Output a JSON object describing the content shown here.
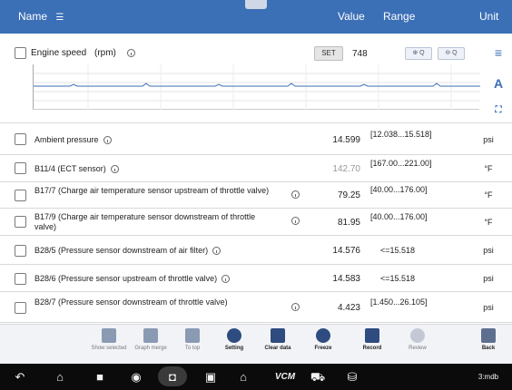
{
  "header": {
    "name_label": "Name",
    "value_label": "Value",
    "range_label": "Range",
    "unit_label": "Unit"
  },
  "graph": {
    "param_name": "Engine speed",
    "param_unit": "(rpm)",
    "set_label": "SET",
    "current_value": "748"
  },
  "rows": [
    {
      "name": "Ambient pressure",
      "value": "14.599",
      "range": "[12.038...15.518]",
      "unit": "psi",
      "info_inline": true
    },
    {
      "name": "B11/4 (ECT sensor)",
      "value": "142.70",
      "range": "[167.00...221.00]",
      "unit": "°F",
      "info_inline": true,
      "dim": true
    },
    {
      "name": "B17/7 (Charge air temperature sensor upstream of throttle valve)",
      "value": "79.25",
      "range": "[40.00...176.00]",
      "unit": "°F"
    },
    {
      "name": "B17/9 (Charge air temperature sensor downstream of throttle valve)",
      "value": "81.95",
      "range": "[40.00...176.00]",
      "unit": "°F"
    },
    {
      "name": "B28/5 (Pressure sensor downstream of air filter)",
      "value": "14.576",
      "range": "<=15.518",
      "unit": "psi",
      "info_inline": true
    },
    {
      "name": "B28/6 (Pressure sensor upstream of throttle valve)",
      "value": "14.583",
      "range": "<=15.518",
      "unit": "psi",
      "info_inline": true
    },
    {
      "name": "B28/7 (Pressure sensor downstream of throttle valve)",
      "value": "4.423",
      "range": "[1.450...26.105]",
      "unit": "psi"
    }
  ],
  "toolbar": [
    {
      "label": "Show selected",
      "icon": "list-icon"
    },
    {
      "label": "Graph merge",
      "icon": "graph-merge-icon"
    },
    {
      "label": "To top",
      "icon": "to-top-icon"
    },
    {
      "label": "Setting",
      "icon": "gear-icon",
      "active": true
    },
    {
      "label": "Clear data",
      "icon": "trash-icon",
      "active": true
    },
    {
      "label": "Freeze",
      "icon": "freeze-icon",
      "active": true
    },
    {
      "label": "Record",
      "icon": "record-icon",
      "active": true
    },
    {
      "label": "Review",
      "icon": "review-icon"
    },
    {
      "label": "Back",
      "icon": "back-icon",
      "active": true
    }
  ],
  "navbar": {
    "vcm_label": "VCM",
    "time_label": "3:mdb"
  }
}
